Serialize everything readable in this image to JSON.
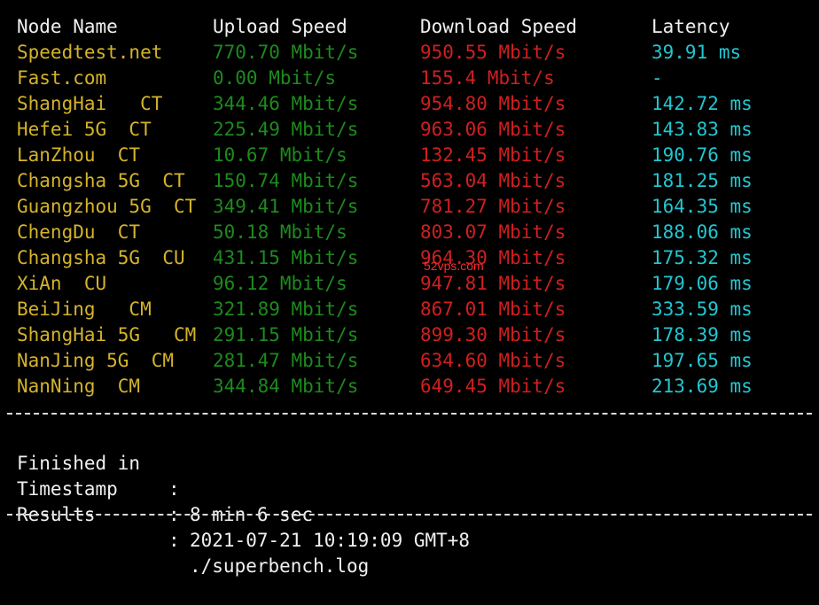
{
  "header": {
    "node_name": "Node Name",
    "upload_speed": "Upload Speed",
    "download_speed": "Download Speed",
    "latency": "Latency"
  },
  "rows": [
    {
      "node": "Speedtest.net",
      "upload": "770.70 Mbit/s",
      "download": "950.55 Mbit/s",
      "latency": "39.91 ms"
    },
    {
      "node": "Fast.com",
      "upload": "0.00 Mbit/s",
      "download": "155.4 Mbit/s",
      "latency": "-"
    },
    {
      "node": "ShangHai   CT",
      "upload": "344.46 Mbit/s",
      "download": "954.80 Mbit/s",
      "latency": "142.72 ms"
    },
    {
      "node": "Hefei 5G  CT",
      "upload": "225.49 Mbit/s",
      "download": "963.06 Mbit/s",
      "latency": "143.83 ms"
    },
    {
      "node": "LanZhou  CT",
      "upload": "10.67 Mbit/s",
      "download": "132.45 Mbit/s",
      "latency": "190.76 ms"
    },
    {
      "node": "Changsha 5G  CT",
      "upload": "150.74 Mbit/s",
      "download": "563.04 Mbit/s",
      "latency": "181.25 ms"
    },
    {
      "node": "Guangzhou 5G  CT",
      "upload": "349.41 Mbit/s",
      "download": "781.27 Mbit/s",
      "latency": "164.35 ms"
    },
    {
      "node": "ChengDu  CT",
      "upload": "50.18 Mbit/s",
      "download": "803.07 Mbit/s",
      "latency": "188.06 ms"
    },
    {
      "node": "Changsha 5G  CU",
      "upload": "431.15 Mbit/s",
      "download": "964.30 Mbit/s",
      "latency": "175.32 ms"
    },
    {
      "node": "XiAn  CU",
      "upload": "96.12 Mbit/s",
      "download": "947.81 Mbit/s",
      "latency": "179.06 ms"
    },
    {
      "node": "BeiJing   CM",
      "upload": "321.89 Mbit/s",
      "download": "867.01 Mbit/s",
      "latency": "333.59 ms"
    },
    {
      "node": "ShangHai 5G   CM",
      "upload": "291.15 Mbit/s",
      "download": "899.30 Mbit/s",
      "latency": "178.39 ms"
    },
    {
      "node": "NanJing 5G  CM",
      "upload": "281.47 Mbit/s",
      "download": "634.60 Mbit/s",
      "latency": "197.65 ms"
    },
    {
      "node": "NanNing  CM",
      "upload": "344.84 Mbit/s",
      "download": "649.45 Mbit/s",
      "latency": "213.69 ms"
    }
  ],
  "summary": {
    "finished_label": "Finished in",
    "finished_value": "8 min 6 sec",
    "timestamp_label": "Timestamp",
    "timestamp_value": "2021-07-21 10:19:09 GMT+8",
    "results_label": "Results",
    "results_value": "./superbench.log",
    "separator": ":"
  },
  "watermark": "52vps.com",
  "colors": {
    "background": "#000000",
    "node_name": "#d4b32b",
    "upload": "#1d8a1d",
    "download": "#d11f1f",
    "latency": "#22c6d0",
    "text": "#f0f0f0"
  }
}
